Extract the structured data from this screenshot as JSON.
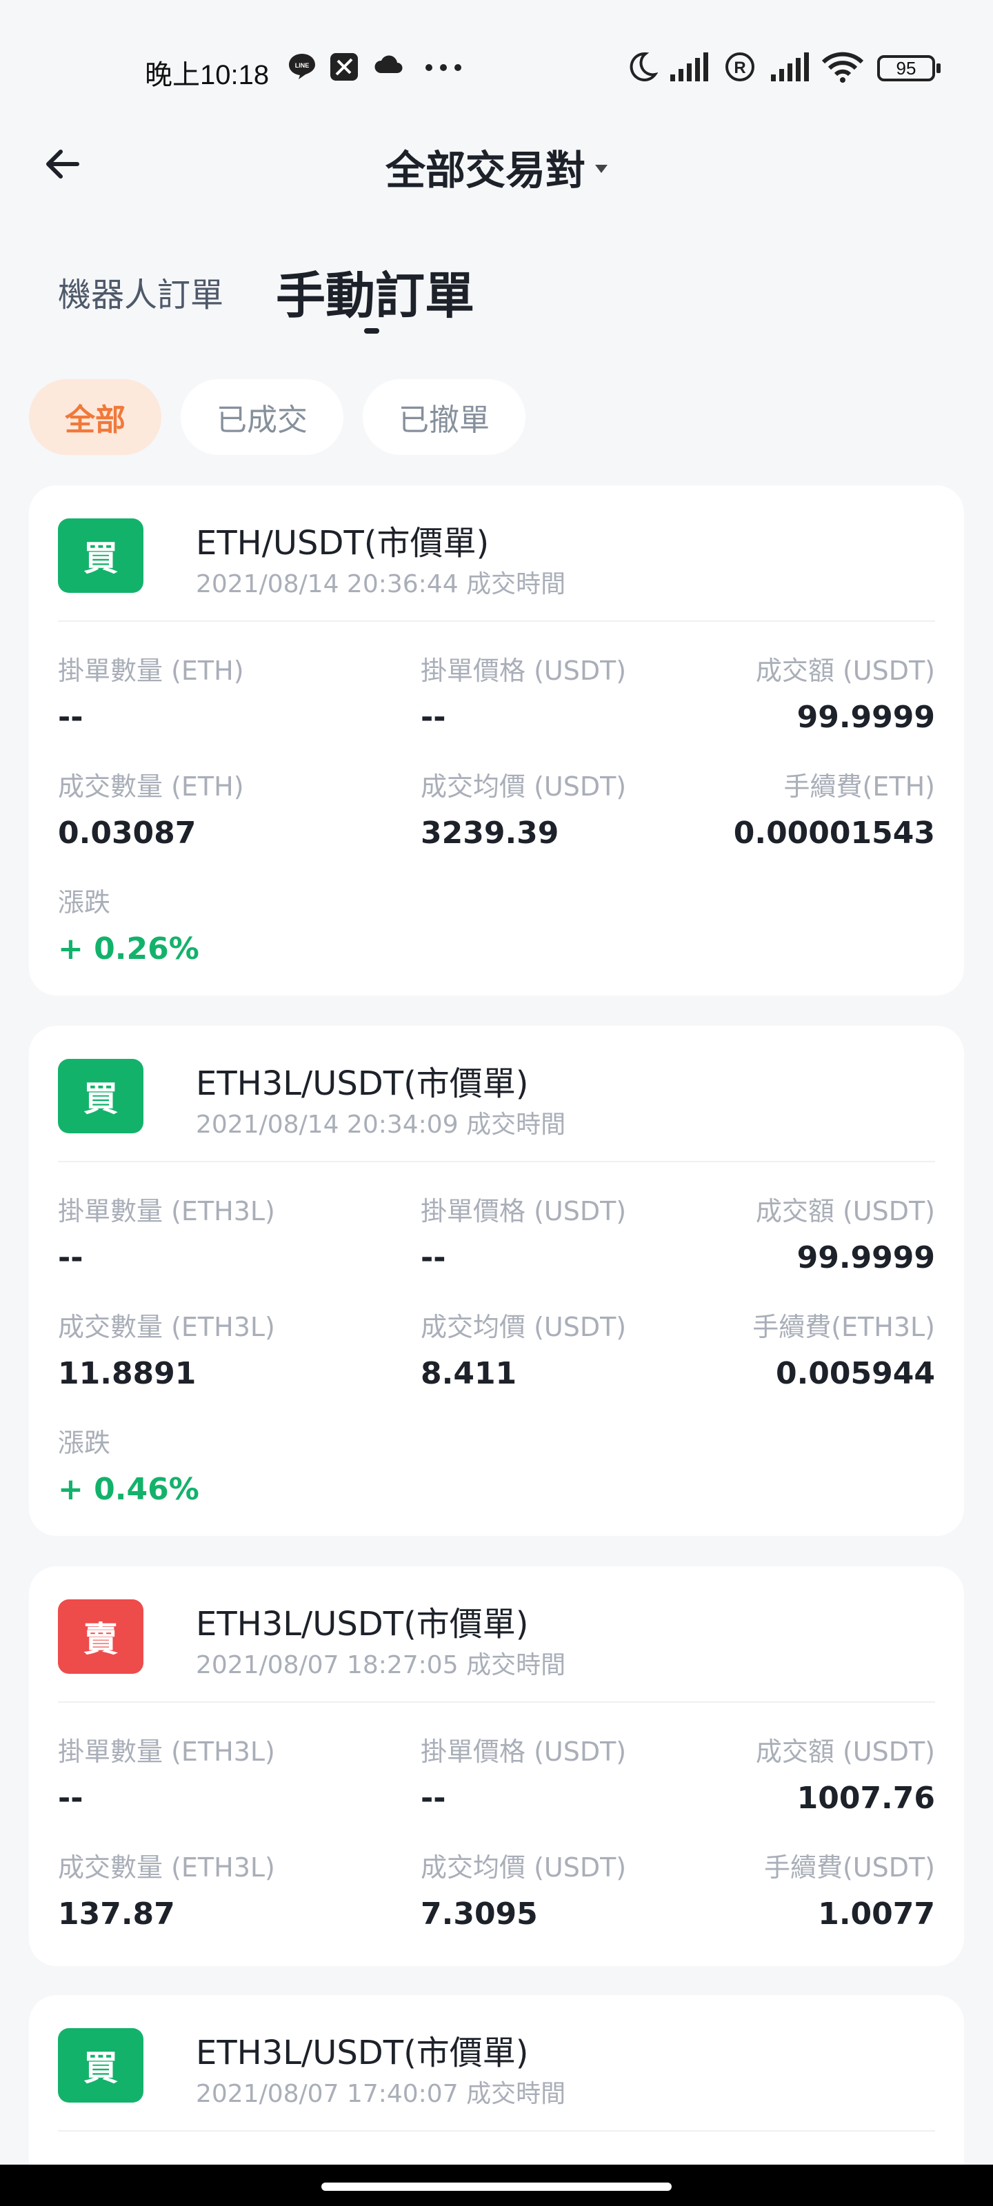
{
  "status_bar": {
    "time": "晚上10:18",
    "battery": "95",
    "icons": [
      "line-icon",
      "app-icon",
      "cloud-icon",
      "more-dots-icon",
      "moon-icon",
      "signal-icon",
      "registered-icon",
      "signal-icon",
      "wifi-icon",
      "battery-icon"
    ]
  },
  "header": {
    "title": "全部交易對",
    "back_icon": "arrow-left-icon",
    "dropdown_icon": "caret-down-icon"
  },
  "tabs": {
    "robot": "機器人訂單",
    "manual": "手動訂單",
    "active": "manual"
  },
  "filters": [
    {
      "label": "全部",
      "active": true
    },
    {
      "label": "已成交",
      "active": false
    },
    {
      "label": "已撤單",
      "active": false
    }
  ],
  "colors": {
    "buy": "#13b26b",
    "sell": "#ee4b4b",
    "accent": "#f0793a",
    "accent_bg": "#fde8dc"
  },
  "orders": [
    {
      "side": "買",
      "pair": "ETH/USDT(市價單)",
      "time": "2021/08/14 20:36:44 成交時間",
      "fields": [
        {
          "label": "掛單數量 (ETH)",
          "value": "--"
        },
        {
          "label": "掛單價格 (USDT)",
          "value": "--"
        },
        {
          "label": "成交額 (USDT)",
          "value": "99.9999"
        },
        {
          "label": "成交數量 (ETH)",
          "value": "0.03087"
        },
        {
          "label": "成交均價 (USDT)",
          "value": "3239.39"
        },
        {
          "label": "手續費(ETH)",
          "value": "0.00001543"
        },
        {
          "label": "漲跌",
          "value": "+ 0.26%"
        }
      ]
    },
    {
      "side": "買",
      "pair": "ETH3L/USDT(市價單)",
      "time": "2021/08/14 20:34:09 成交時間",
      "fields": [
        {
          "label": "掛單數量 (ETH3L)",
          "value": "--"
        },
        {
          "label": "掛單價格 (USDT)",
          "value": "--"
        },
        {
          "label": "成交額 (USDT)",
          "value": "99.9999"
        },
        {
          "label": "成交數量 (ETH3L)",
          "value": "11.8891"
        },
        {
          "label": "成交均價 (USDT)",
          "value": "8.411"
        },
        {
          "label": "手續費(ETH3L)",
          "value": "0.005944"
        },
        {
          "label": "漲跌",
          "value": "+ 0.46%"
        }
      ]
    },
    {
      "side": "賣",
      "pair": "ETH3L/USDT(市價單)",
      "time": "2021/08/07 18:27:05 成交時間",
      "fields": [
        {
          "label": "掛單數量 (ETH3L)",
          "value": "--"
        },
        {
          "label": "掛單價格 (USDT)",
          "value": "--"
        },
        {
          "label": "成交額 (USDT)",
          "value": "1007.76"
        },
        {
          "label": "成交數量 (ETH3L)",
          "value": "137.87"
        },
        {
          "label": "成交均價 (USDT)",
          "value": "7.3095"
        },
        {
          "label": "手續費(USDT)",
          "value": "1.0077"
        }
      ]
    },
    {
      "side": "買",
      "pair": "ETH3L/USDT(市價單)",
      "time": "2021/08/07 17:40:07 成交時間",
      "fields": []
    }
  ]
}
